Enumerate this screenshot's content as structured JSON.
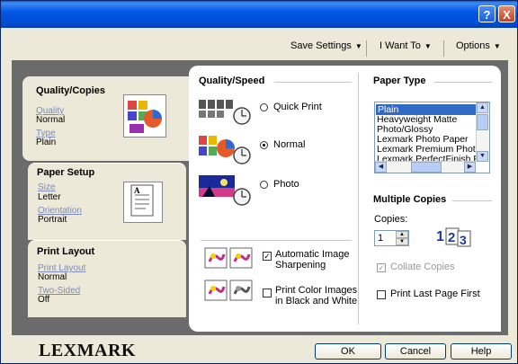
{
  "titlebar": {
    "help_label": "?",
    "close_label": "X"
  },
  "menubar": {
    "save_settings": "Save Settings",
    "i_want_to": "I Want To",
    "options": "Options"
  },
  "tabs": {
    "quality_copies": {
      "title": "Quality/Copies",
      "quality_label": "Quality",
      "quality_value": "Normal",
      "type_label": "Type",
      "type_value": "Plain"
    },
    "paper_setup": {
      "title": "Paper Setup",
      "size_label": "Size",
      "size_value": "Letter",
      "orientation_label": "Orientation",
      "orientation_value": "Portrait"
    },
    "print_layout": {
      "title": "Print Layout",
      "layout_label": "Print Layout",
      "layout_value": "Normal",
      "two_sided_label": "Two-Sided",
      "two_sided_value": "Off"
    }
  },
  "quality_speed": {
    "title": "Quality/Speed",
    "options": [
      {
        "label": "Quick Print",
        "selected": false
      },
      {
        "label": "Normal",
        "selected": true
      },
      {
        "label": "Photo",
        "selected": false
      }
    ]
  },
  "image_options": {
    "sharpening": {
      "label_line1": "Automatic Image",
      "label_line2": "Sharpening",
      "checked": true
    },
    "black_white": {
      "label_line1": "Print Color Images",
      "label_line2": "in Black and White",
      "checked": false
    }
  },
  "paper_type": {
    "title": "Paper Type",
    "items": [
      "Plain",
      "Heavyweight Matte",
      "Photo/Glossy",
      "Lexmark Photo Paper",
      "Lexmark Premium Photo",
      "Lexmark PerfectFinish Photo"
    ],
    "selected": "Plain"
  },
  "multiple_copies": {
    "title": "Multiple Copies",
    "copies_label": "Copies:",
    "copies_value": "1",
    "collate_label": "Collate Copies",
    "collate_checked": true,
    "collate_enabled": false,
    "last_page_first_label": "Print Last Page First",
    "last_page_first_checked": false
  },
  "footer": {
    "logo": "LEXMARK",
    "ok": "OK",
    "cancel": "Cancel",
    "help": "Help"
  },
  "colors": {
    "titlebar": "#0054e3",
    "selection": "#316ac5",
    "dialog_bg": "#ece9d8"
  }
}
